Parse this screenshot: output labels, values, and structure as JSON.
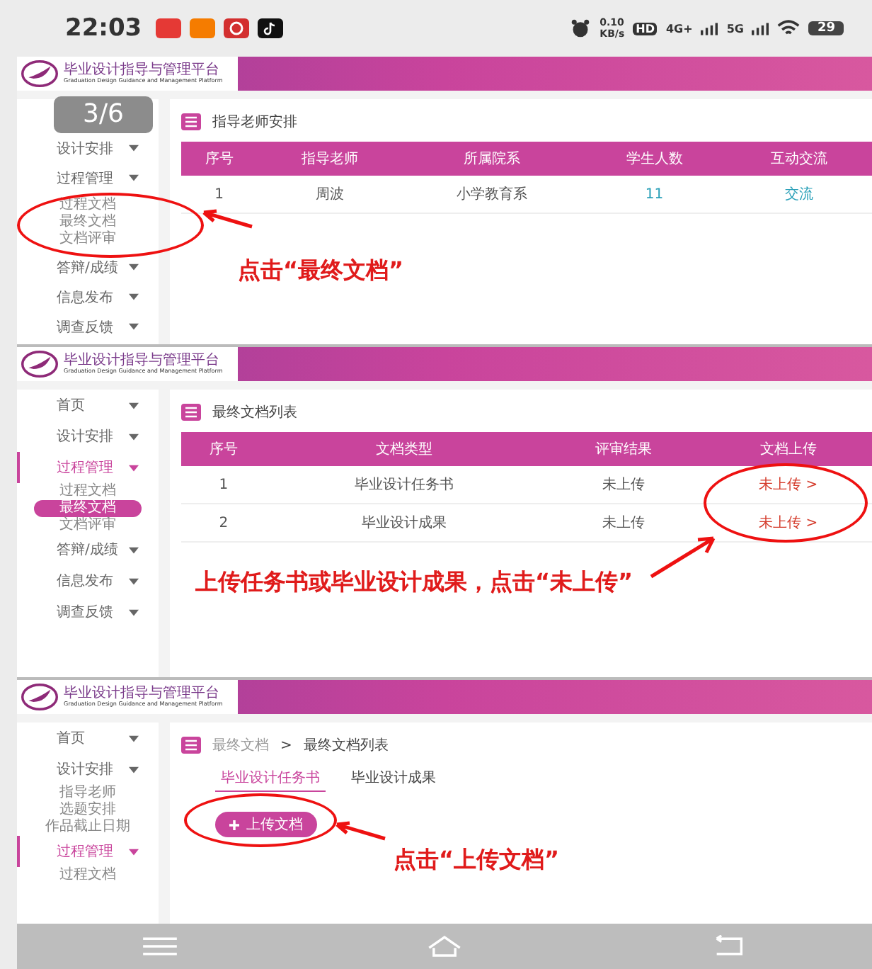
{
  "status_bar": {
    "time": "22:03",
    "net_speed": "0.10",
    "net_unit": "KB/s",
    "hd": "HD",
    "net_4g": "4G+",
    "net_5g": "5G",
    "battery": "29"
  },
  "panels": [
    {
      "kind": "teachers",
      "header": {
        "title": "毕业设计指导与管理平台",
        "subtitle": "Graduation Design Guidance and Management Platform"
      },
      "page_badge": "3/6",
      "sidebar": [
        {
          "label": "设计安排",
          "selected": false
        },
        {
          "label": "过程管理",
          "selected": false,
          "children": [
            {
              "label": "过程文档",
              "selected": false
            },
            {
              "label": "最终文档",
              "selected": false
            },
            {
              "label": "文档评审",
              "selected": false
            }
          ]
        },
        {
          "label": "答辩/成绩",
          "selected": false
        },
        {
          "label": "信息发布",
          "selected": false
        },
        {
          "label": "调查反馈",
          "selected": false
        }
      ],
      "section_title": "指导老师安排",
      "table": {
        "columns": [
          "序号",
          "指导老师",
          "所属院系",
          "学生人数",
          "互动交流"
        ],
        "rows": [
          [
            {
              "text": "1",
              "kind": "text"
            },
            {
              "text": "周波",
              "kind": "text"
            },
            {
              "text": "小学教育系",
              "kind": "text"
            },
            {
              "text": "11",
              "kind": "link"
            },
            {
              "text": "交流",
              "kind": "link"
            }
          ]
        ]
      },
      "annotation": "点击“最终文档”"
    },
    {
      "kind": "documents",
      "header": {
        "title": "毕业设计指导与管理平台",
        "subtitle": "Graduation Design Guidance and Management Platform"
      },
      "sidebar": [
        {
          "label": "首页",
          "selected": false
        },
        {
          "label": "设计安排",
          "selected": false
        },
        {
          "label": "过程管理",
          "selected": true,
          "children": [
            {
              "label": "过程文档",
              "selected": false
            },
            {
              "label": "最终文档",
              "selected": true
            },
            {
              "label": "文档评审",
              "selected": false
            }
          ]
        },
        {
          "label": "答辩/成绩",
          "selected": false
        },
        {
          "label": "信息发布",
          "selected": false
        },
        {
          "label": "调查反馈",
          "selected": false
        }
      ],
      "section_title": "最终文档列表",
      "table": {
        "columns": [
          "序号",
          "文档类型",
          "评审结果",
          "文档上传"
        ],
        "rows": [
          [
            {
              "text": "1",
              "kind": "text"
            },
            {
              "text": "毕业设计任务书",
              "kind": "text"
            },
            {
              "text": "未上传",
              "kind": "text"
            },
            {
              "text": "未上传 >",
              "kind": "alert"
            }
          ],
          [
            {
              "text": "2",
              "kind": "text"
            },
            {
              "text": "毕业设计成果",
              "kind": "text"
            },
            {
              "text": "未上传",
              "kind": "text"
            },
            {
              "text": "未上传 >",
              "kind": "alert"
            }
          ]
        ]
      },
      "annotation": "上传任务书或毕业设计成果，点击“未上传”"
    },
    {
      "kind": "upload",
      "header": {
        "title": "毕业设计指导与管理平台",
        "subtitle": "Graduation Design Guidance and Management Platform"
      },
      "sidebar": [
        {
          "label": "首页",
          "selected": false
        },
        {
          "label": "设计安排",
          "selected": false,
          "children": [
            {
              "label": "指导老师",
              "selected": false
            },
            {
              "label": "选题安排",
              "selected": false
            },
            {
              "label": "作品截止日期",
              "selected": false
            }
          ]
        },
        {
          "label": "过程管理",
          "selected": true,
          "children": [
            {
              "label": "过程文档",
              "selected": false
            }
          ]
        }
      ],
      "breadcrumb": [
        "最终文档",
        "最终文档列表"
      ],
      "breadcrumb_separator": ">",
      "tabs": [
        {
          "label": "毕业设计任务书",
          "selected": true
        },
        {
          "label": "毕业设计成果",
          "selected": false
        }
      ],
      "upload_button": "上传文档",
      "annotation": "点击“上传文档”"
    }
  ]
}
